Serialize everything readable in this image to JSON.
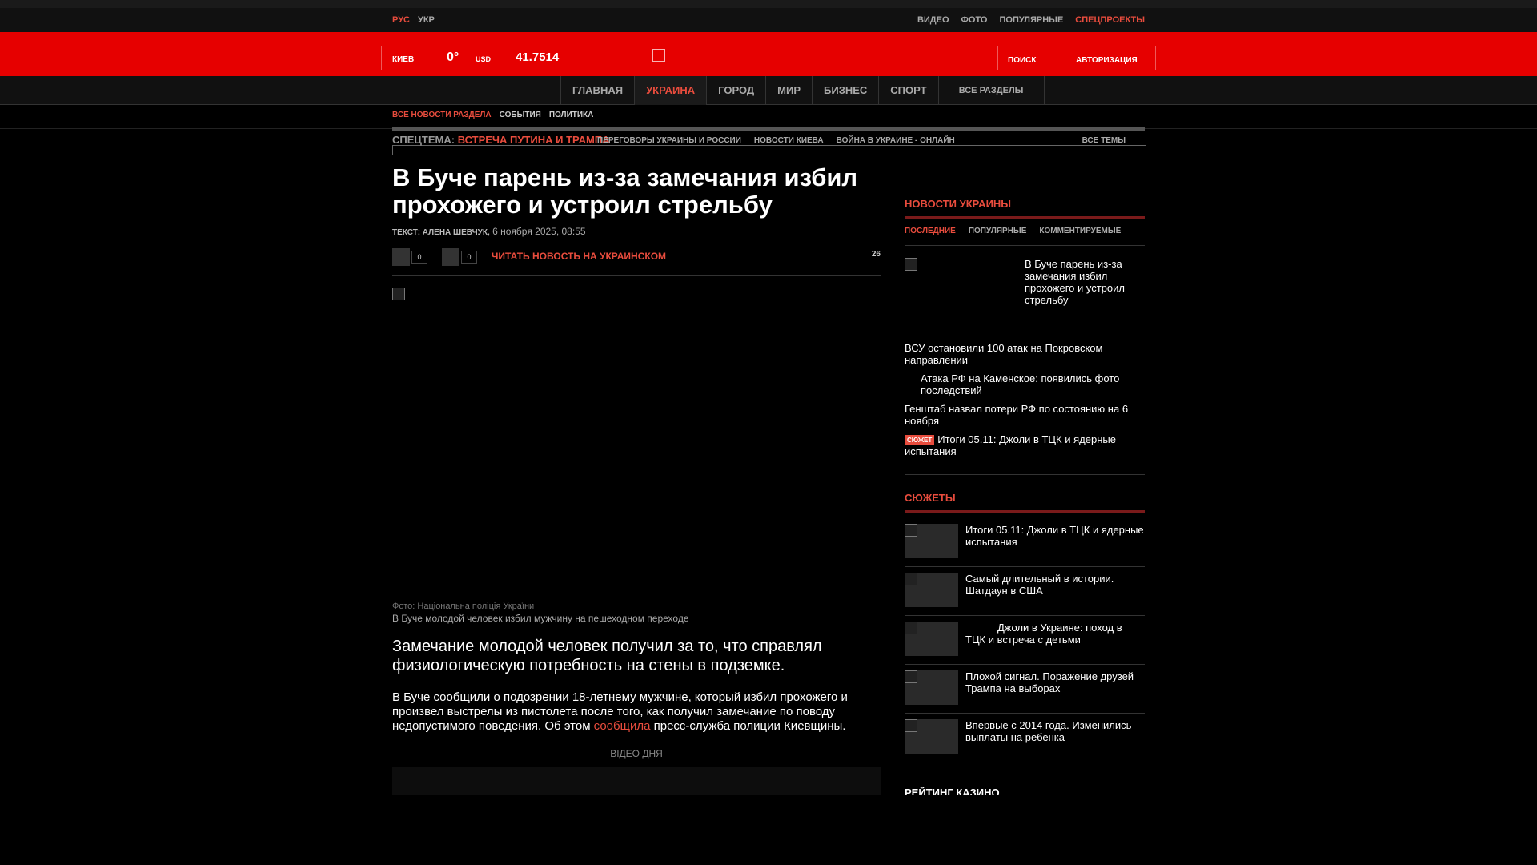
{
  "top": {
    "lang_ru": "РУС",
    "lang_ua": "УКР",
    "links": [
      "ВИДЕО",
      "ФОТО",
      "ПОПУЛЯРНЫЕ"
    ],
    "special": "СПЕЦПРОЕКТЫ"
  },
  "header": {
    "city": "КИЕВ",
    "temp": "0°",
    "currency": "USD",
    "rate": "41.7514",
    "search": "ПОИСК",
    "login": "АВТОРИЗАЦИЯ"
  },
  "nav": {
    "items": [
      "ГЛАВНАЯ",
      "УКРАИНА",
      "ГОРОД",
      "МИР",
      "БИЗНЕС",
      "СПОРТ"
    ],
    "active": "УКРАИНА",
    "all": "ВСЕ РАЗДЕЛЫ"
  },
  "subnav": {
    "all": "ВСЕ НОВОСТИ РАЗДЕЛА",
    "items": [
      "СОБЫТИЯ",
      "ПОЛИТИКА"
    ]
  },
  "spec": {
    "label": "СПЕЦТЕМА:",
    "topic": "ВСТРЕЧА ПУТИНА И ТРАМПА",
    "links": [
      "ПЕРЕГОВОРЫ УКРАИНЫ И РОССИИ",
      "НОВОСТИ КИЕВА",
      "ВОЙНА В УКРАИНЕ - ОНЛАЙН"
    ],
    "all": "ВСЕ ТЕМЫ"
  },
  "article": {
    "title": "В Буче парень из-за замечания избил прохожего и устроил стрельбу",
    "author": "ТЕКСТ: АЛЕНА ШЕВЧУК,",
    "date": "6 ноября 2025, 08:55",
    "share_count_1": "0",
    "share_count_2": "0",
    "read_ukr": "ЧИТАТЬ НОВОСТЬ НА УКРАИНСКОМ",
    "comments": "26",
    "photo_credit": "Фото: Національна поліція України",
    "caption": "В Буче молодой человек избил мужчину на пешеходном переходе",
    "lead": "Замечание молодой человек получил за то, что справлял физиологическую потребность на стены в подземке.",
    "body_1": "В Буче сообщили о подозрении 18-летнему мужчине, который избил прохожего и произвел выстрелы из пистолета после того, как получил замечание по поводу недопустимого поведения. Об этом ",
    "body_link": "сообщила",
    "body_2": " пресс-служба полиции Киевщины.",
    "video_head": "ВІДЕО ДНЯ"
  },
  "sidebar": {
    "news_head": "НОВОСТИ УКРАИНЫ",
    "tabs": [
      "ПОСЛЕДНИЕ",
      "ПОПУЛЯРНЫЕ",
      "КОММЕНТИРУЕМЫЕ"
    ],
    "featured": "В Буче парень из-за замечания избил прохожего и устроил стрельбу",
    "news": [
      "ВСУ остановили 100 атак на Покровском направлении",
      "Атака РФ на Каменское: появились фото последствий",
      "Генштаб назвал потери РФ по состоянию на 6 ноября"
    ],
    "badge": "СЮЖЕТ",
    "news_badged": "Итоги 05.11: Джоли в ТЦК и ядерные испытания",
    "stories_head": "СЮЖЕТЫ",
    "stories": [
      "Итоги 05.11: Джоли в ТЦК и ядерные испытания",
      "Самый длительный в истории. Шатдаун в США",
      "Джоли в Украине: поход в ТЦК и встреча с детьми",
      "Плохой сигнал. Поражение друзей Трампа на выборах",
      "Впервые с 2014 года. Изменились выплаты на ребенка"
    ],
    "casino_head": "РЕЙТИНГ КАЗИНО"
  }
}
